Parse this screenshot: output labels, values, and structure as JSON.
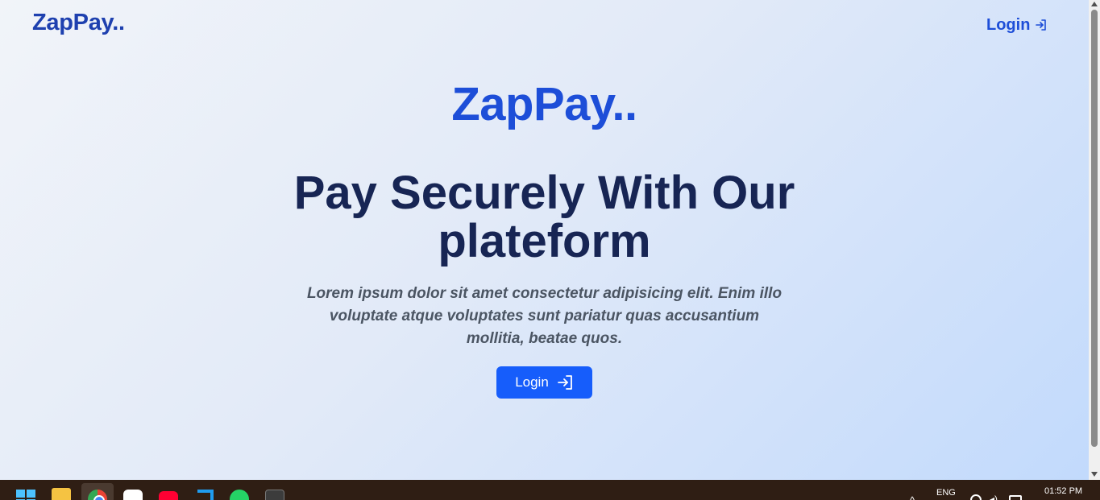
{
  "nav": {
    "logo": "ZapPay..",
    "login_label": "Login",
    "login_icon": "login-arrow-icon"
  },
  "hero": {
    "brand": "ZapPay..",
    "title": "Pay Securely With Our plateform",
    "description": "Lorem ipsum dolor sit amet consectetur adipisicing elit. Enim illo voluptate atque voluptates sunt pariatur quas accusantium mollitia, beatae quos.",
    "button_label": "Login",
    "button_icon": "login-arrow-icon"
  },
  "taskbar": {
    "apps": [
      "windows-start-icon",
      "file-explorer-icon",
      "chrome-icon",
      "chatgpt-icon",
      "youtube-icon",
      "vscode-icon",
      "whatsapp-icon",
      "terminal-icon"
    ],
    "language": "ENG",
    "time": "01:52 PM"
  },
  "colors": {
    "brand_blue": "#1d4ed8",
    "heading_navy": "#172554",
    "button_blue": "#165dfb",
    "text_gray": "#4b5563",
    "taskbar_bg": "#2f1e14"
  }
}
